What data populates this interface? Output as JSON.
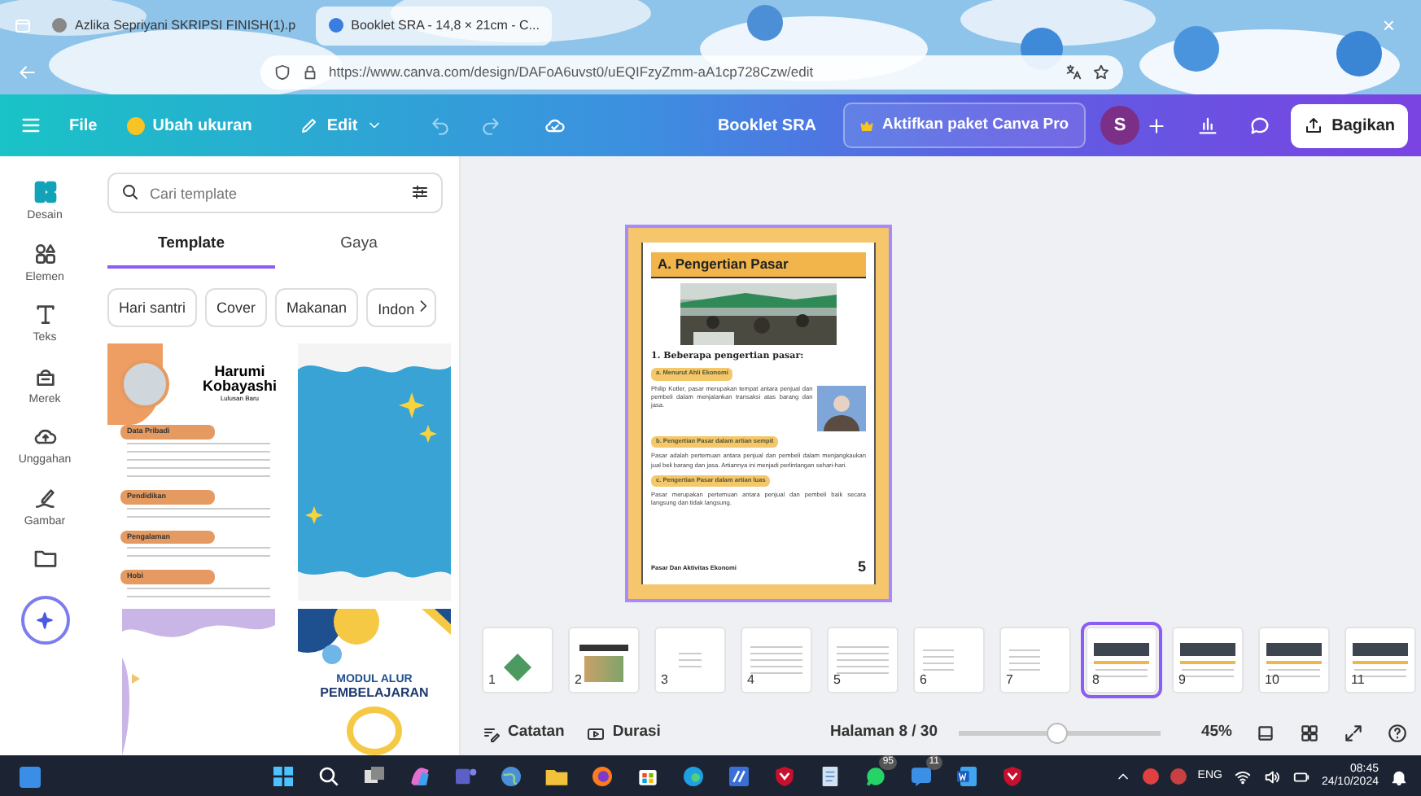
{
  "browser": {
    "tabs": [
      {
        "title": "Azlika Sepriyani SKRIPSI FINISH(1).p",
        "selected": false
      },
      {
        "title": "Booklet SRA - 14,8 × 21cm - C...",
        "selected": true
      }
    ],
    "close": "×",
    "url": "https://www.canva.com/design/DAFoA6uvst0/uEQIFzyZmm-aA1cp728Czw/edit"
  },
  "toolbar": {
    "file": "File",
    "resize": "Ubah ukuran",
    "edit": "Edit",
    "doc_title": "Booklet SRA",
    "pro": "Aktifkan paket Canva Pro",
    "avatar": "S",
    "share": "Bagikan"
  },
  "rail": [
    {
      "kind": "design",
      "label": "Desain",
      "selected": true
    },
    {
      "kind": "elements",
      "label": "Elemen",
      "selected": false
    },
    {
      "kind": "text",
      "label": "Teks",
      "selected": false
    },
    {
      "kind": "brand",
      "label": "Merek",
      "selected": false
    },
    {
      "kind": "upload",
      "label": "Unggahan",
      "selected": false
    },
    {
      "kind": "draw",
      "label": "Gambar",
      "selected": false
    },
    {
      "kind": "folder",
      "selected": false
    }
  ],
  "panel": {
    "search": {
      "placeholder": "Cari template"
    },
    "tabs": [
      {
        "label": "Template",
        "selected": true
      },
      {
        "label": "Gaya",
        "selected": false
      }
    ],
    "chips": [
      "Hari santri",
      "Cover",
      "Makanan",
      "Indon"
    ],
    "templates": [
      {
        "kind": "resume",
        "name": "Harumi",
        "surname": "Kobayashi",
        "subtitle": "Lulusan Baru",
        "sections": [
          "Data Pribadi",
          "Pendidikan",
          "Pengalaman",
          "Hobi"
        ]
      },
      {
        "kind": "frame"
      },
      {
        "kind": "wave"
      },
      {
        "kind": "module",
        "title": "MODUL ALUR",
        "subtitle": "PEMBELAJARAN"
      }
    ]
  },
  "page": {
    "heading": "A. Pengertian Pasar",
    "subheading": "1. Beberapa pengertian pasar:",
    "sections": [
      {
        "title": "a. Menurut Ahli Ekonomi",
        "text": "Philip Kotler, pasar merupakan tempat antara penjual dan pembeli dalam menjalankan transaksi atas barang dan jasa.",
        "has_photo": true
      },
      {
        "title": "b. Pengertian Pasar dalam artian sempit",
        "text": "Pasar adalah pertemuan antara penjual dan pembeli dalam menjangkaukan jual beli barang dan jasa. Artiannya ini menjadi perlintangan sehari-hari.",
        "has_photo": false
      },
      {
        "title": "c. Pengertian Pasar dalam artian luas",
        "text": "Pasar merupakan pertemuan antara penjual dan pembeli baik secara langsung dan tidak langsung.",
        "has_photo": false
      }
    ],
    "footer": "Pasar Dan Aktivitas Ekonomi",
    "number": "5"
  },
  "thumbnails": [
    {
      "number": "1",
      "kind": "logo",
      "selected": false
    },
    {
      "number": "2",
      "kind": "title",
      "selected": false
    },
    {
      "number": "3",
      "kind": "center",
      "selected": false
    },
    {
      "number": "4",
      "kind": "text",
      "selected": false
    },
    {
      "number": "5",
      "kind": "text",
      "selected": false
    },
    {
      "number": "6",
      "kind": "list",
      "selected": false
    },
    {
      "number": "7",
      "kind": "list",
      "selected": false
    },
    {
      "number": "8",
      "selected": true
    },
    {
      "number": "9",
      "selected": false
    },
    {
      "number": "10",
      "selected": false
    },
    {
      "number": "11",
      "selected": false
    }
  ],
  "footer": {
    "notes": "Catatan",
    "duration": "Durasi",
    "page": "Halaman 8 / 30",
    "zoom_slider": {
      "level": 0.48
    },
    "zoom": "45%"
  },
  "taskbar": {
    "apps": [
      {
        "kind": "start"
      },
      {
        "kind": "search"
      },
      {
        "kind": "taskview"
      },
      {
        "kind": "copilot"
      },
      {
        "kind": "teams"
      },
      {
        "kind": "globe"
      },
      {
        "kind": "folder"
      },
      {
        "kind": "firefox"
      },
      {
        "kind": "store"
      },
      {
        "kind": "edge"
      },
      {
        "kind": "app"
      },
      {
        "kind": "shield"
      },
      {
        "kind": "notepad"
      },
      {
        "kind": "chat",
        "badge": "95"
      },
      {
        "kind": "app2",
        "badge": "11"
      },
      {
        "kind": "word"
      },
      {
        "kind": "shield"
      }
    ],
    "lang": "ENG",
    "time": "08:45",
    "date": "24/10/2024"
  }
}
